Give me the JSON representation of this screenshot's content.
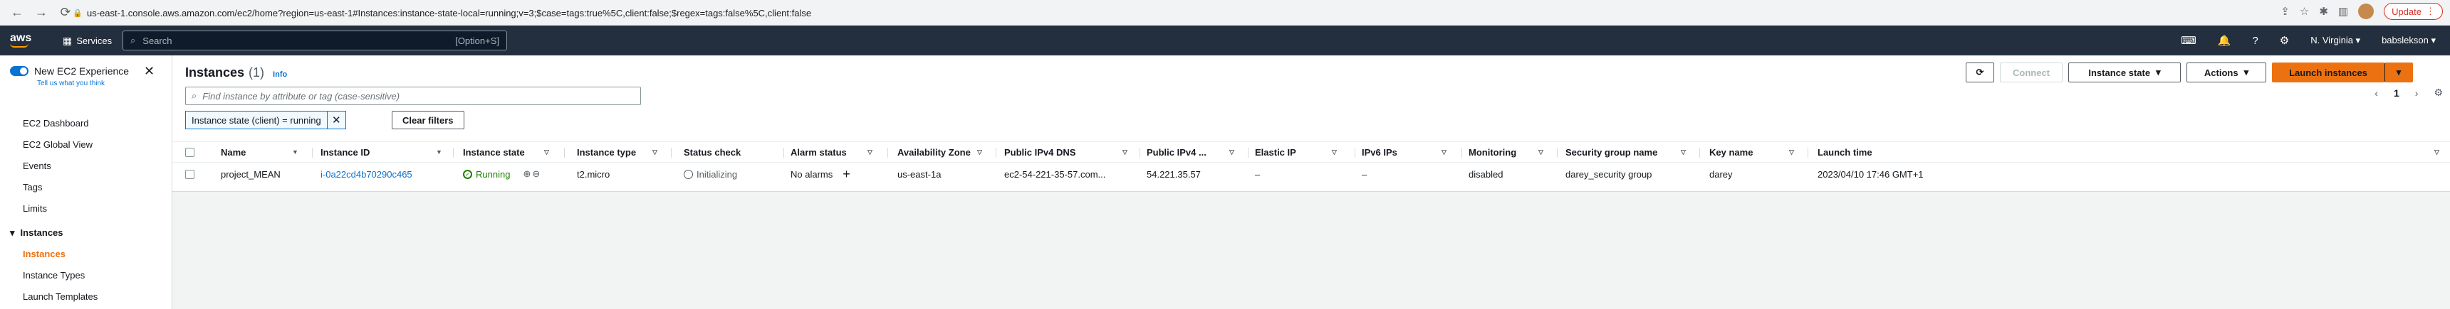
{
  "browser": {
    "url": "us-east-1.console.aws.amazon.com/ec2/home?region=us-east-1#Instances:instance-state-local=running;v=3;$case=tags:true%5C,client:false;$regex=tags:false%5C,client:false",
    "update_label": "Update"
  },
  "topnav": {
    "logo": "aws",
    "services_label": "Services",
    "search_placeholder": "Search",
    "search_shortcut": "[Option+S]",
    "region": "N. Virginia",
    "user": "babslekson"
  },
  "sidebar": {
    "new_experience_label": "New EC2 Experience",
    "tell_us": "Tell us what you think",
    "items_top": [
      "EC2 Dashboard",
      "EC2 Global View",
      "Events",
      "Tags",
      "Limits"
    ],
    "section_instances": "Instances",
    "items_instances": [
      "Instances",
      "Instance Types",
      "Launch Templates"
    ]
  },
  "main": {
    "title": "Instances",
    "count": "(1)",
    "info": "Info",
    "buttons": {
      "refresh": "⟳",
      "connect": "Connect",
      "instance_state": "Instance state",
      "actions": "Actions",
      "launch": "Launch instances"
    },
    "filter_placeholder": "Find instance by attribute or tag (case-sensitive)",
    "active_filter": "Instance state (client) = running",
    "clear_filters": "Clear filters",
    "page_number": "1",
    "columns": [
      "Name",
      "Instance ID",
      "Instance state",
      "Instance type",
      "Status check",
      "Alarm status",
      "Availability Zone",
      "Public IPv4 DNS",
      "Public IPv4 ...",
      "Elastic IP",
      "IPv6 IPs",
      "Monitoring",
      "Security group name",
      "Key name",
      "Launch time"
    ],
    "row": {
      "name": "project_MEAN",
      "instance_id": "i-0a22cd4b70290c465",
      "state": "Running",
      "type": "t2.micro",
      "status_check": "Initializing",
      "alarm_status": "No alarms",
      "az": "us-east-1a",
      "dns": "ec2-54-221-35-57.com...",
      "ipv4": "54.221.35.57",
      "elastic_ip": "–",
      "ipv6": "–",
      "monitoring": "disabled",
      "security_group": "darey_security group",
      "key_name": "darey",
      "launch_time": "2023/04/10 17:46 GMT+1"
    }
  }
}
